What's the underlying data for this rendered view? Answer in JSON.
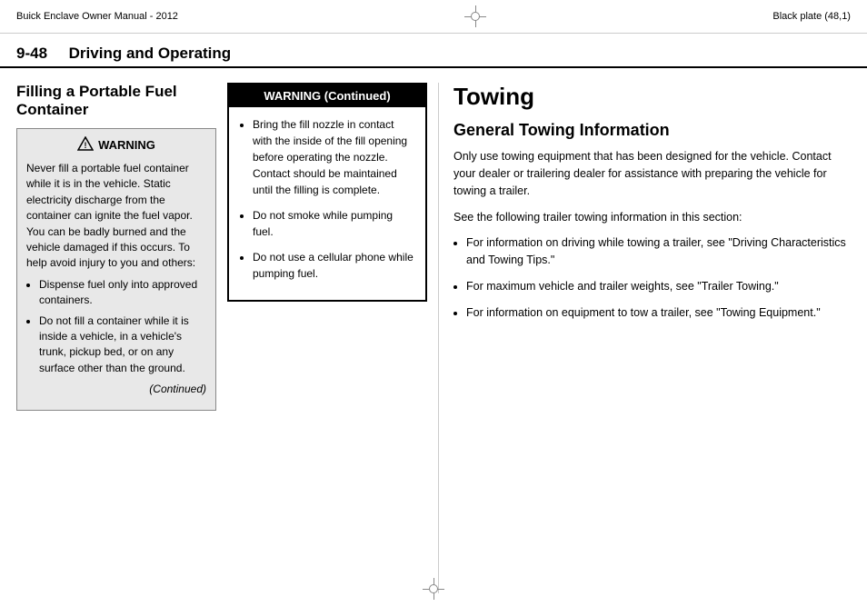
{
  "header": {
    "left": "Buick Enclave Owner Manual - 2012",
    "right": "Black plate (48,1)"
  },
  "section": {
    "number": "9-48",
    "title": "Driving and Operating"
  },
  "left_column": {
    "heading": "Filling a Portable Fuel Container",
    "warning_title": "WARNING",
    "warning_body": "Never fill a portable fuel container while it is in the vehicle. Static electricity discharge from the container can ignite the fuel vapor. You can be badly burned and the vehicle damaged if this occurs. To help avoid injury to you and others:",
    "warning_bullets": [
      "Dispense fuel only into approved containers.",
      "Do not fill a container while it is inside a vehicle, in a vehicle's trunk, pickup bed, or on any surface other than the ground."
    ],
    "continued": "(Continued)"
  },
  "middle_column": {
    "title": "WARNING  (Continued)",
    "bullets": [
      "Bring the fill nozzle in contact with the inside of the fill opening before operating the nozzle. Contact should be maintained until the filling is complete.",
      "Do not smoke while pumping fuel.",
      "Do not use a cellular phone while pumping fuel."
    ]
  },
  "right_column": {
    "main_heading": "Towing",
    "sub_heading": "General Towing Information",
    "intro": "Only use towing equipment that has been designed for the vehicle. Contact your dealer or trailering dealer for assistance with preparing the vehicle for towing a trailer.",
    "see_following": "See the following trailer towing information in this section:",
    "bullets": [
      "For information on driving while towing a trailer, see \"Driving Characteristics and Towing Tips.\"",
      "For maximum vehicle and trailer weights, see \"Trailer Towing.\"",
      "For information on equipment to tow a trailer, see \"Towing Equipment.\""
    ]
  }
}
